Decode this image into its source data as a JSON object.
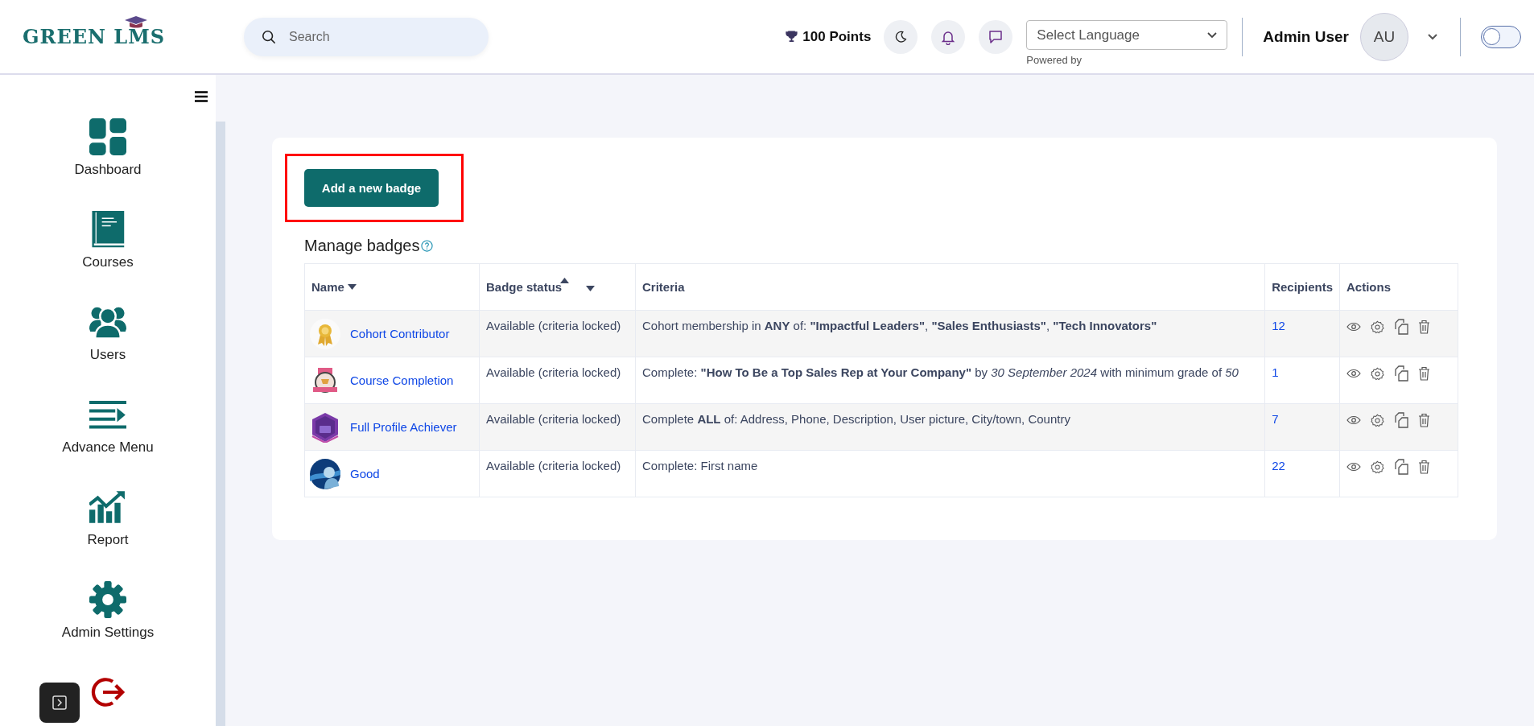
{
  "header": {
    "logo": "GREEN LMS",
    "search": {
      "placeholder": "Search"
    },
    "points": "100 Points",
    "language": {
      "value": "Select Language",
      "note": "Powered by"
    },
    "user": {
      "name": "Admin User",
      "initials": "AU"
    },
    "theme_toggle": {
      "on": false
    }
  },
  "sidebar": {
    "items": [
      {
        "label": "Dashboard",
        "kind": "dashboard"
      },
      {
        "label": "Courses",
        "kind": "book"
      },
      {
        "label": "Users",
        "kind": "users"
      },
      {
        "label": "Advance Menu",
        "kind": "menu"
      },
      {
        "label": "Report",
        "kind": "report"
      },
      {
        "label": "Admin Settings",
        "kind": "settings"
      },
      {
        "kind": "logout"
      }
    ]
  },
  "page": {
    "add_button": "Add a new badge",
    "title": "Manage badges",
    "table": {
      "columns": [
        {
          "label": "Name",
          "sort_up": false,
          "sort_down": true
        },
        {
          "label": "Badge status",
          "sort_up": true,
          "sort_down": true
        },
        {
          "label": "Criteria",
          "sort_up": false,
          "sort_down": false
        },
        {
          "label": "Recipients",
          "sort_up": false,
          "sort_down": false
        },
        {
          "label": "Actions",
          "sort_up": false,
          "sort_down": false
        }
      ],
      "rows": [
        {
          "name": "Cohort Contributor",
          "status": "Available (criteria locked)",
          "criteria": "Cohort membership in **ANY** of: **\"Impactful Leaders\"**, **\"Sales Enthusiasts\"**, **\"Tech Innovators\"**",
          "recipients": "12"
        },
        {
          "name": "Course Completion",
          "status": "Available (criteria locked)",
          "criteria": "Complete: **\"How To Be a Top Sales Rep at Your Company\"** by *30 September 2024* with minimum grade of *50*",
          "recipients": "1"
        },
        {
          "name": "Full Profile Achiever",
          "status": "Available (criteria locked)",
          "criteria": "Complete **ALL** of: Address, Phone, Description, User picture, City/town, Country",
          "recipients": "7"
        },
        {
          "name": "Good",
          "status": "Available (criteria locked)",
          "criteria": "Complete: First name",
          "recipients": "22"
        }
      ]
    }
  }
}
